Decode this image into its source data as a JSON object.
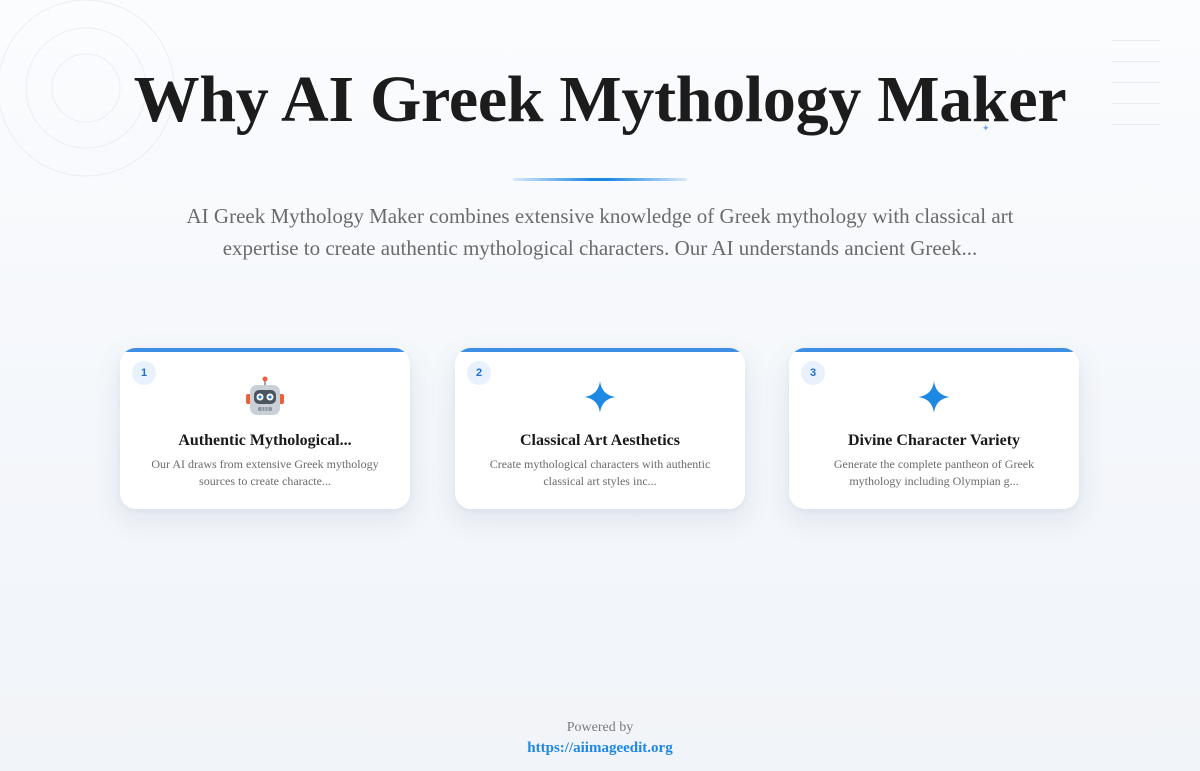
{
  "hero": {
    "title": "Why AI Greek Mythology Maker",
    "description": "AI Greek Mythology Maker combines extensive knowledge of Greek mythology with classical art expertise to create authentic mythological characters. Our AI understands ancient Greek...",
    "accent_color": "#1e88e5"
  },
  "cards": [
    {
      "number": "1",
      "icon": "robot-icon",
      "title": "Authentic Mythological...",
      "description": "Our AI draws from extensive Greek mythology sources to create characte..."
    },
    {
      "number": "2",
      "icon": "sparkle-icon",
      "title": "Classical Art Aesthetics",
      "description": "Create mythological characters with authentic classical art styles inc..."
    },
    {
      "number": "3",
      "icon": "sparkle-icon",
      "title": "Divine Character Variety",
      "description": "Generate the complete pantheon of Greek mythology including Olympian g..."
    }
  ],
  "footer": {
    "powered_by": "Powered by",
    "link_text": "https://aiimageedit.org"
  }
}
